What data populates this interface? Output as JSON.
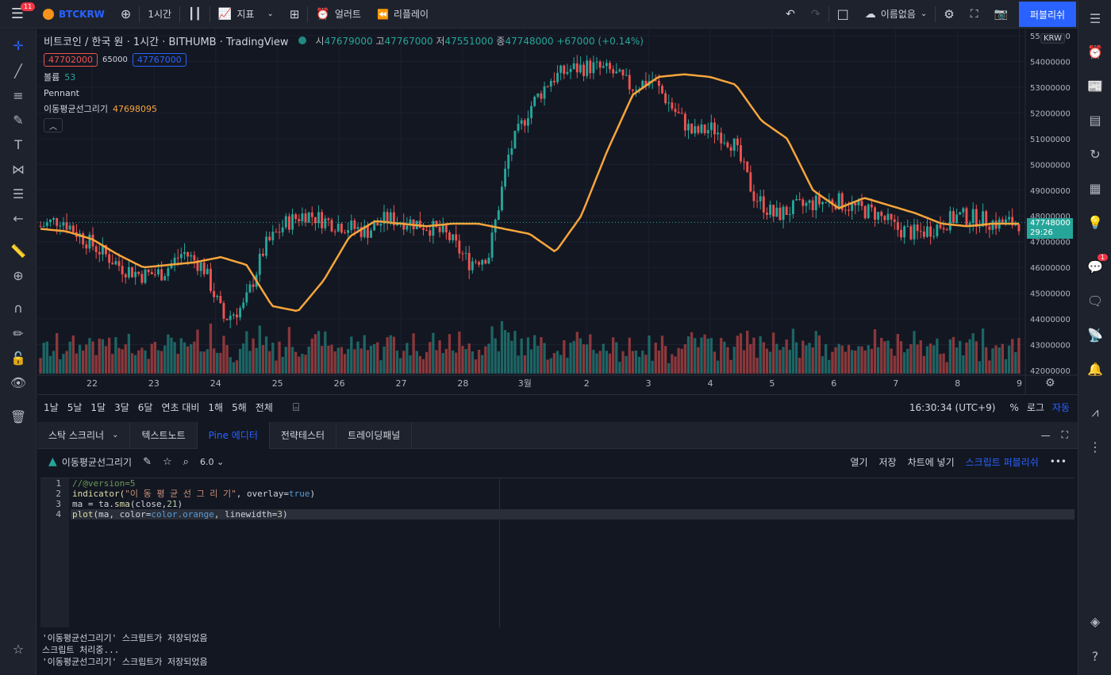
{
  "topbar": {
    "notif_count": "11",
    "symbol": "BTCKRW",
    "interval": "1시간",
    "indicators_label": "지표",
    "alert_label": "얼러트",
    "replay_label": "리플레이",
    "layout_name": "이름없음",
    "publish_label": "퍼블리쉬"
  },
  "legend": {
    "title": "비트코인 / 한국 원 · 1시간 · BITHUMB · TradingView",
    "open_label": "시",
    "open": "47679000",
    "high_label": "고",
    "high": "47767000",
    "low_label": "저",
    "low": "47551000",
    "close_label": "종",
    "close": "47748000",
    "change": "+67000 (+0.14%)",
    "bid": "47702000",
    "spread": "65000",
    "ask": "47767000",
    "volume_label": "볼륨",
    "volume": "53",
    "pattern_label": "Pennant",
    "ma_label": "이동평균선그리기",
    "ma_value": "47698095"
  },
  "price_axis": {
    "currency": "KRW",
    "labels": [
      "55000000",
      "54000000",
      "53000000",
      "52000000",
      "51000000",
      "50000000",
      "49000000",
      "48000000",
      "47000000",
      "46000000",
      "45000000",
      "44000000",
      "43000000",
      "42000000"
    ],
    "current_price": "47748000",
    "countdown": "29:26"
  },
  "time_axis": [
    "22",
    "23",
    "24",
    "25",
    "26",
    "27",
    "28",
    "3월",
    "2",
    "3",
    "4",
    "5",
    "6",
    "7",
    "8",
    "9"
  ],
  "ranges": [
    "1날",
    "5날",
    "1달",
    "3달",
    "6달",
    "연초 대비",
    "1해",
    "5해",
    "전체"
  ],
  "clock": "16:30:34 (UTC+9)",
  "scale_opts": {
    "percent": "%",
    "log": "로그",
    "auto": "자동"
  },
  "tabs": [
    "스탁 스크리너",
    "텍스트노트",
    "Pine 에디터",
    "전략테스터",
    "트레이딩패널"
  ],
  "editor": {
    "script_name": "이동평균선그리기",
    "version": "6.0",
    "open_label": "열기",
    "save_label": "저장",
    "add_to_chart": "차트에 넣기",
    "publish_script": "스크립트 퍼블리쉬",
    "line_numbers": [
      "1",
      "2",
      "3",
      "4"
    ],
    "lines": {
      "l1": "//@version=5",
      "l2a": "indicator(",
      "l2b": "\"이 동 평 균 선 그 리 기\"",
      "l2c": ", overlay=",
      "l2d": "true",
      "l2e": ")",
      "l3a": "ma = ta.",
      "l3b": "sma",
      "l3c": "(close,",
      "l3d": "21",
      "l3e": ")",
      "l4a": "plot",
      "l4b": "(ma, color=",
      "l4c": "color.orange",
      "l4d": ", linewidth=",
      "l4e": "3",
      "l4f": ")"
    }
  },
  "console": [
    "'이동평균선그리기' 스크립트가 저장되었음",
    "스크립트 처리중...",
    "'이동평균선그리기' 스크립트가 저장되었음"
  ],
  "right_badge": "1",
  "colors": {
    "up": "#26a69a",
    "down": "#ef5350",
    "ma": "#f7a53b",
    "accent": "#2962ff",
    "bg": "#131722"
  },
  "chart_data": {
    "type": "candlestick",
    "x": [
      "22",
      "23",
      "24",
      "25",
      "26",
      "27",
      "28",
      "3월",
      "2",
      "3",
      "4",
      "5",
      "6",
      "7",
      "8",
      "9"
    ],
    "ma_series_name": "이동평균선그리기",
    "ylim": [
      42000000,
      55000000
    ],
    "close_path": [
      47600000,
      47900000,
      47200000,
      46600000,
      46000000,
      45700000,
      45800000,
      46600000,
      46000000,
      44000000,
      44500000,
      46800000,
      47700000,
      48100000,
      47800000,
      47600000,
      47400000,
      47900000,
      47800000,
      47600000,
      47200000,
      46200000,
      46500000,
      50500000,
      52200000,
      53300000,
      53700000,
      53800000,
      53600000,
      53000000,
      53300000,
      52200000,
      51200000,
      51400000,
      50800000,
      48800000,
      48000000,
      48300000,
      48500000,
      48600000,
      48300000,
      48100000,
      47500000,
      47300000,
      47600000,
      48000000,
      47900000,
      47700000,
      47748000
    ],
    "ma_path": [
      47500000,
      47400000,
      47100000,
      46500000,
      46000000,
      46100000,
      46200000,
      46400000,
      46100000,
      44500000,
      44300000,
      45500000,
      47200000,
      47800000,
      47700000,
      47600000,
      47700000,
      47700000,
      47500000,
      47300000,
      46600000,
      48000000,
      50500000,
      52700000,
      53400000,
      53500000,
      53400000,
      53100000,
      51700000,
      51000000,
      49000000,
      48300000,
      48700000,
      48400000,
      48100000,
      47700000,
      47600000,
      47700000,
      47698095
    ]
  }
}
